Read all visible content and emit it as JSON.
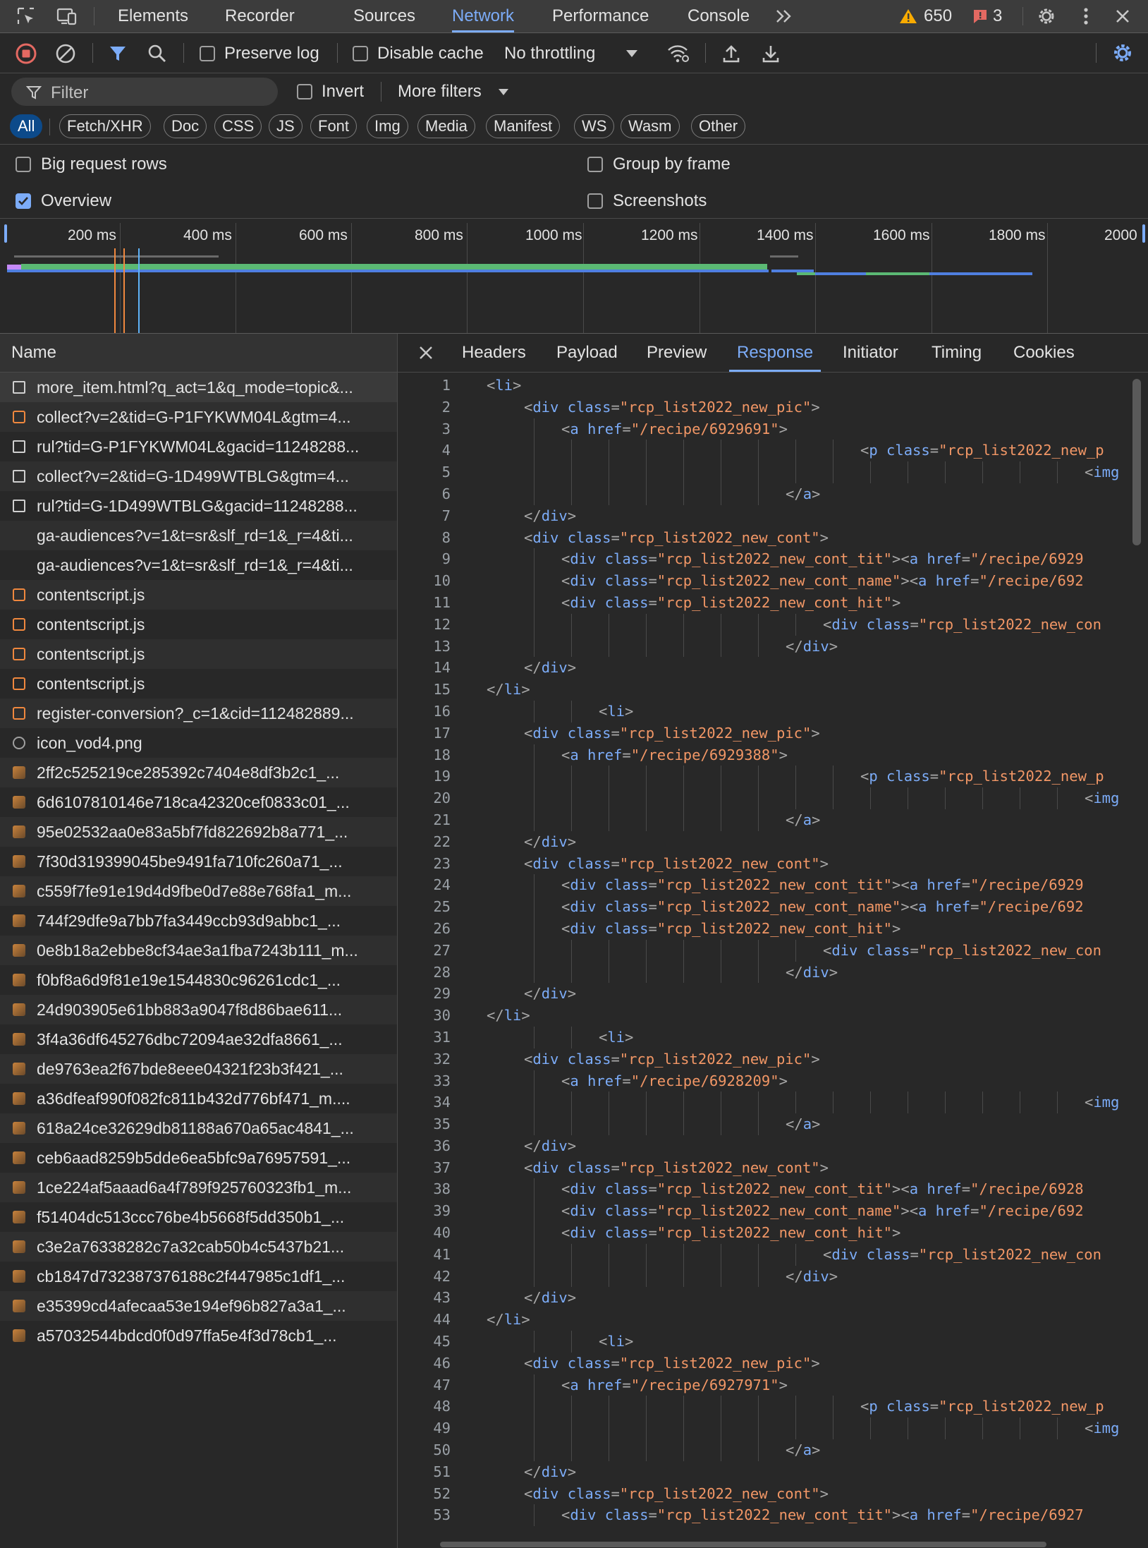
{
  "topbar": {
    "tabs": [
      "Elements",
      "Recorder",
      "Sources",
      "Network",
      "Performance",
      "Console"
    ],
    "active_tab": "Network",
    "warnings_count": "650",
    "errors_count": "3",
    "icons": [
      "inspect-element-icon",
      "device-toolbar-icon",
      "more-tabs-icon",
      "warning-icon",
      "error-icon",
      "settings-icon",
      "kebab-menu-icon",
      "close-icon"
    ]
  },
  "toolbar": {
    "preserve_log_label": "Preserve log",
    "preserve_log_checked": false,
    "disable_cache_label": "Disable cache",
    "disable_cache_checked": false,
    "throttling_value": "No throttling",
    "icons": [
      "record-stop-icon",
      "clear-icon",
      "filter-icon",
      "search-icon",
      "network-conditions-icon",
      "import-har-icon",
      "export-har-icon",
      "network-settings-icon"
    ]
  },
  "filter": {
    "placeholder": "Filter",
    "invert_label": "Invert",
    "invert_checked": false,
    "more_filters_label": "More filters",
    "types": [
      "All",
      "Fetch/XHR",
      "Doc",
      "CSS",
      "JS",
      "Font",
      "Img",
      "Media",
      "Manifest",
      "WS",
      "Wasm",
      "Other"
    ],
    "active_type": "All"
  },
  "options": {
    "big_request_rows": {
      "label": "Big request rows",
      "checked": false
    },
    "group_by_frame": {
      "label": "Group by frame",
      "checked": false
    },
    "overview": {
      "label": "Overview",
      "checked": true
    },
    "screenshots": {
      "label": "Screenshots",
      "checked": false
    }
  },
  "overview": {
    "ticks": [
      "200 ms",
      "400 ms",
      "600 ms",
      "800 ms",
      "1000 ms",
      "1200 ms",
      "1400 ms",
      "1600 ms",
      "1800 ms",
      "2000"
    ]
  },
  "requests": {
    "header": "Name",
    "items": [
      {
        "name": "more_item.html?q_act=1&q_mode=topic&...",
        "type": "document"
      },
      {
        "name": "collect?v=2&tid=G-P1FYKWM04L&gtm=4...",
        "type": "script"
      },
      {
        "name": "rul?tid=G-P1FYKWM04L&gacid=11248288...",
        "type": "document"
      },
      {
        "name": "collect?v=2&tid=G-1D499WTBLG&gtm=4...",
        "type": "document"
      },
      {
        "name": "rul?tid=G-1D499WTBLG&gacid=11248288...",
        "type": "document"
      },
      {
        "name": "ga-audiences?v=1&t=sr&slf_rd=1&_r=4&ti...",
        "type": "none"
      },
      {
        "name": "ga-audiences?v=1&t=sr&slf_rd=1&_r=4&ti...",
        "type": "none"
      },
      {
        "name": "contentscript.js",
        "type": "script"
      },
      {
        "name": "contentscript.js",
        "type": "script"
      },
      {
        "name": "contentscript.js",
        "type": "script"
      },
      {
        "name": "contentscript.js",
        "type": "script"
      },
      {
        "name": "register-conversion?_c=1&cid=112482889...",
        "type": "script"
      },
      {
        "name": "icon_vod4.png",
        "type": "media"
      },
      {
        "name": "2ff2c525219ce285392c7404e8df3b2c1_...",
        "type": "image"
      },
      {
        "name": "6d6107810146e718ca42320cef0833c01_...",
        "type": "image"
      },
      {
        "name": "95e02532aa0e83a5bf7fd822692b8a771_...",
        "type": "image"
      },
      {
        "name": "7f30d319399045be9491fa710fc260a71_...",
        "type": "image"
      },
      {
        "name": "c559f7fe91e19d4d9fbe0d7e88e768fa1_m...",
        "type": "image"
      },
      {
        "name": "744f29dfe9a7bb7fa3449ccb93d9abbc1_...",
        "type": "image"
      },
      {
        "name": "0e8b18a2ebbe8cf34ae3a1fba7243b111_m...",
        "type": "image"
      },
      {
        "name": "f0bf8a6d9f81e19e1544830c96261cdc1_...",
        "type": "image"
      },
      {
        "name": "24d903905e61bb883a9047f8d86bae611...",
        "type": "image"
      },
      {
        "name": "3f4a36df645276dbc72094ae32dfa8661_...",
        "type": "image"
      },
      {
        "name": "de9763ea2f67bde8eee04321f23b3f421_...",
        "type": "image"
      },
      {
        "name": "a36dfeaf990f082fc811b432d776bf471_m....",
        "type": "image"
      },
      {
        "name": "618a24ce32629db81188a670a65ac4841_...",
        "type": "image"
      },
      {
        "name": "ceb6aad8259b5dde6ea5bfc9a76957591_...",
        "type": "image"
      },
      {
        "name": "1ce224af5aaad6a4f789f925760323fb1_m...",
        "type": "image"
      },
      {
        "name": "f51404dc513ccc76be4b5668f5dd350b1_...",
        "type": "image"
      },
      {
        "name": "c3e2a76338282c7a32cab50b4c5437b21...",
        "type": "image"
      },
      {
        "name": "cb1847d732387376188c2f447985c1df1_...",
        "type": "image"
      },
      {
        "name": "e35399cd4afecaa53e194ef96b827a3a1_...",
        "type": "image"
      },
      {
        "name": "a57032544bdcd0f0d97ffa5e4f3d78cb1_...",
        "type": "image"
      }
    ]
  },
  "detail": {
    "tabs": [
      "Headers",
      "Payload",
      "Preview",
      "Response",
      "Initiator",
      "Timing",
      "Cookies"
    ],
    "active_tab": "Response",
    "code_lines": [
      {
        "n": "1",
        "i": 0,
        "g": [],
        "t": "<li>"
      },
      {
        "n": "2",
        "i": 1,
        "g": [],
        "t": "<div class=\"rcp_list2022_new_pic\">"
      },
      {
        "n": "3",
        "i": 2,
        "g": [
          1
        ],
        "t": "<a href=\"/recipe/6929691\">"
      },
      {
        "n": "4",
        "i": 10,
        "g": [
          1,
          2,
          3,
          4,
          5,
          6,
          7,
          8,
          9
        ],
        "t": "<p class=\"rcp_list2022_new_p"
      },
      {
        "n": "5",
        "i": 16,
        "g": [
          1,
          2,
          3,
          4,
          5,
          6,
          7,
          8,
          9,
          10,
          11,
          12,
          13,
          14,
          15
        ],
        "t": "<img"
      },
      {
        "n": "6",
        "i": 8,
        "g": [
          1,
          2,
          3,
          4,
          5,
          6,
          7
        ],
        "t": "</a>"
      },
      {
        "n": "7",
        "i": 1,
        "g": [],
        "t": "</div>"
      },
      {
        "n": "8",
        "i": 1,
        "g": [],
        "t": "<div class=\"rcp_list2022_new_cont\">"
      },
      {
        "n": "9",
        "i": 2,
        "g": [
          1
        ],
        "t": "<div class=\"rcp_list2022_new_cont_tit\"><a href=\"/recipe/6929"
      },
      {
        "n": "10",
        "i": 2,
        "g": [
          1
        ],
        "t": "<div class=\"rcp_list2022_new_cont_name\"><a href=\"/recipe/692"
      },
      {
        "n": "11",
        "i": 2,
        "g": [
          1
        ],
        "t": "<div class=\"rcp_list2022_new_cont_hit\">"
      },
      {
        "n": "12",
        "i": 9,
        "g": [
          1,
          2,
          3,
          4,
          5,
          6,
          7,
          8
        ],
        "t": "<div class=\"rcp_list2022_new_con"
      },
      {
        "n": "13",
        "i": 8,
        "g": [
          1,
          2,
          3,
          4,
          5,
          6,
          7
        ],
        "t": "</div>"
      },
      {
        "n": "14",
        "i": 1,
        "g": [],
        "t": "</div>"
      },
      {
        "n": "15",
        "i": 0,
        "g": [],
        "t": "</li>"
      },
      {
        "n": "16",
        "i": 3,
        "g": [
          1,
          2
        ],
        "t": "<li>"
      },
      {
        "n": "17",
        "i": 1,
        "g": [],
        "t": "<div class=\"rcp_list2022_new_pic\">"
      },
      {
        "n": "18",
        "i": 2,
        "g": [
          1
        ],
        "t": "<a href=\"/recipe/6929388\">"
      },
      {
        "n": "19",
        "i": 10,
        "g": [
          1,
          2,
          3,
          4,
          5,
          6,
          7,
          8,
          9
        ],
        "t": "<p class=\"rcp_list2022_new_p"
      },
      {
        "n": "20",
        "i": 16,
        "g": [
          1,
          2,
          3,
          4,
          5,
          6,
          7,
          8,
          9,
          10,
          11,
          12,
          13,
          14,
          15
        ],
        "t": "<img"
      },
      {
        "n": "21",
        "i": 8,
        "g": [
          1,
          2,
          3,
          4,
          5,
          6,
          7
        ],
        "t": "</a>"
      },
      {
        "n": "22",
        "i": 1,
        "g": [],
        "t": "</div>"
      },
      {
        "n": "23",
        "i": 1,
        "g": [],
        "t": "<div class=\"rcp_list2022_new_cont\">"
      },
      {
        "n": "24",
        "i": 2,
        "g": [
          1
        ],
        "t": "<div class=\"rcp_list2022_new_cont_tit\"><a href=\"/recipe/6929"
      },
      {
        "n": "25",
        "i": 2,
        "g": [
          1
        ],
        "t": "<div class=\"rcp_list2022_new_cont_name\"><a href=\"/recipe/692"
      },
      {
        "n": "26",
        "i": 2,
        "g": [
          1
        ],
        "t": "<div class=\"rcp_list2022_new_cont_hit\">"
      },
      {
        "n": "27",
        "i": 9,
        "g": [
          1,
          2,
          3,
          4,
          5,
          6,
          7,
          8
        ],
        "t": "<div class=\"rcp_list2022_new_con"
      },
      {
        "n": "28",
        "i": 8,
        "g": [
          1,
          2,
          3,
          4,
          5,
          6,
          7
        ],
        "t": "</div>"
      },
      {
        "n": "29",
        "i": 1,
        "g": [],
        "t": "</div>"
      },
      {
        "n": "30",
        "i": 0,
        "g": [],
        "t": "</li>"
      },
      {
        "n": "31",
        "i": 3,
        "g": [
          1,
          2
        ],
        "t": "<li>"
      },
      {
        "n": "32",
        "i": 1,
        "g": [],
        "t": "<div class=\"rcp_list2022_new_pic\">"
      },
      {
        "n": "33",
        "i": 2,
        "g": [
          1
        ],
        "t": "<a href=\"/recipe/6928209\">"
      },
      {
        "n": "34",
        "i": 16,
        "g": [
          1,
          2,
          3,
          4,
          5,
          6,
          7,
          8,
          9,
          10,
          11,
          12,
          13,
          14,
          15
        ],
        "t": "<img"
      },
      {
        "n": "35",
        "i": 8,
        "g": [
          1,
          2,
          3,
          4,
          5,
          6,
          7
        ],
        "t": "</a>"
      },
      {
        "n": "36",
        "i": 1,
        "g": [],
        "t": "</div>"
      },
      {
        "n": "37",
        "i": 1,
        "g": [],
        "t": "<div class=\"rcp_list2022_new_cont\">"
      },
      {
        "n": "38",
        "i": 2,
        "g": [
          1
        ],
        "t": "<div class=\"rcp_list2022_new_cont_tit\"><a href=\"/recipe/6928"
      },
      {
        "n": "39",
        "i": 2,
        "g": [
          1
        ],
        "t": "<div class=\"rcp_list2022_new_cont_name\"><a href=\"/recipe/692"
      },
      {
        "n": "40",
        "i": 2,
        "g": [
          1
        ],
        "t": "<div class=\"rcp_list2022_new_cont_hit\">"
      },
      {
        "n": "41",
        "i": 9,
        "g": [
          1,
          2,
          3,
          4,
          5,
          6,
          7,
          8
        ],
        "t": "<div class=\"rcp_list2022_new_con"
      },
      {
        "n": "42",
        "i": 8,
        "g": [
          1,
          2,
          3,
          4,
          5,
          6,
          7
        ],
        "t": "</div>"
      },
      {
        "n": "43",
        "i": 1,
        "g": [],
        "t": "</div>"
      },
      {
        "n": "44",
        "i": 0,
        "g": [],
        "t": "</li>"
      },
      {
        "n": "45",
        "i": 3,
        "g": [
          1,
          2
        ],
        "t": "<li>"
      },
      {
        "n": "46",
        "i": 1,
        "g": [],
        "t": "<div class=\"rcp_list2022_new_pic\">"
      },
      {
        "n": "47",
        "i": 2,
        "g": [
          1
        ],
        "t": "<a href=\"/recipe/6927971\">"
      },
      {
        "n": "48",
        "i": 10,
        "g": [
          1,
          2,
          3,
          4,
          5,
          6,
          7,
          8,
          9
        ],
        "t": "<p class=\"rcp_list2022_new_p"
      },
      {
        "n": "49",
        "i": 16,
        "g": [
          1,
          2,
          3,
          4,
          5,
          6,
          7,
          8,
          9,
          10,
          11,
          12,
          13,
          14,
          15
        ],
        "t": "<img"
      },
      {
        "n": "50",
        "i": 8,
        "g": [
          1,
          2,
          3,
          4,
          5,
          6,
          7
        ],
        "t": "</a>"
      },
      {
        "n": "51",
        "i": 1,
        "g": [],
        "t": "</div>"
      },
      {
        "n": "52",
        "i": 1,
        "g": [],
        "t": "<div class=\"rcp_list2022_new_cont\">"
      },
      {
        "n": "53",
        "i": 2,
        "g": [
          1
        ],
        "t": "<div class=\"rcp_list2022_new_cont_tit\"><a href=\"/recipe/6927"
      }
    ]
  },
  "colors": {
    "accent": "#7cacf8",
    "warning": "#f9ab00",
    "error": "#f28b82",
    "waterfall_green": "#5bb974",
    "waterfall_blue": "#4f7fe0"
  }
}
